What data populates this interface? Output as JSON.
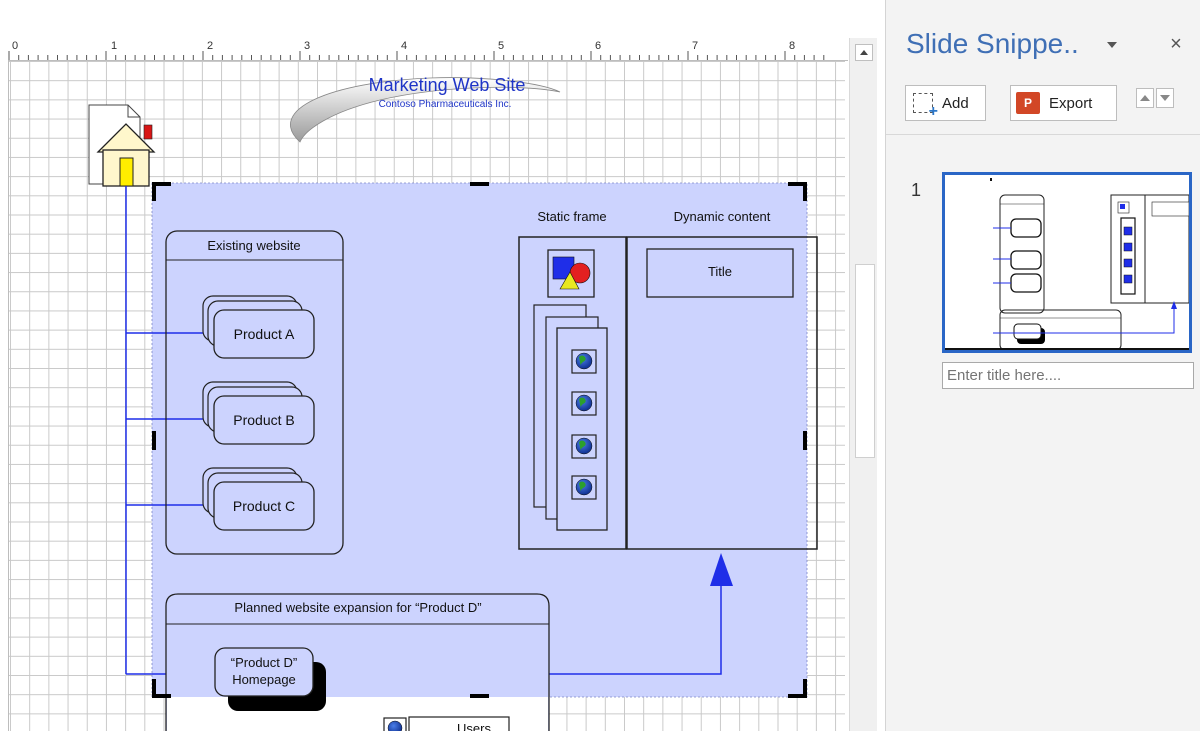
{
  "ruler": {
    "numbers": [
      "0",
      "1",
      "2",
      "3",
      "4",
      "5",
      "6",
      "7",
      "8"
    ]
  },
  "diagram": {
    "header_title": "Marketing Web Site",
    "header_subtitle": "Contoso Pharmaceuticals Inc.",
    "existing_label": "Existing website",
    "products": [
      "Product A",
      "Product B",
      "Product C"
    ],
    "static_frame": "Static frame",
    "dynamic_content": "Dynamic content",
    "title_box": "Title",
    "planned_label": "Planned website expansion for “Product D”",
    "homepage_line1": "“Product D”",
    "homepage_line2": "Homepage",
    "users_label": "Users"
  },
  "panel": {
    "title": "Slide Snippe..",
    "close": "×",
    "add_label": "Add",
    "export_label": "Export",
    "ppt_glyph": "P",
    "snippet_number": "1",
    "title_placeholder": "Enter title here...."
  },
  "colors": {
    "selection_fill": "#ccd3fe",
    "connector": "#1f2ee8",
    "header_blue": "#1f35c7",
    "panel_title": "#3f6fb5",
    "thumb_border": "#2a66c6"
  },
  "icons": [
    "home-page-icon",
    "shapes-icon",
    "globe-icon",
    "add-icon",
    "powerpoint-icon",
    "close-icon",
    "dropdown-icon",
    "arrow-up-icon",
    "arrow-down-icon"
  ]
}
